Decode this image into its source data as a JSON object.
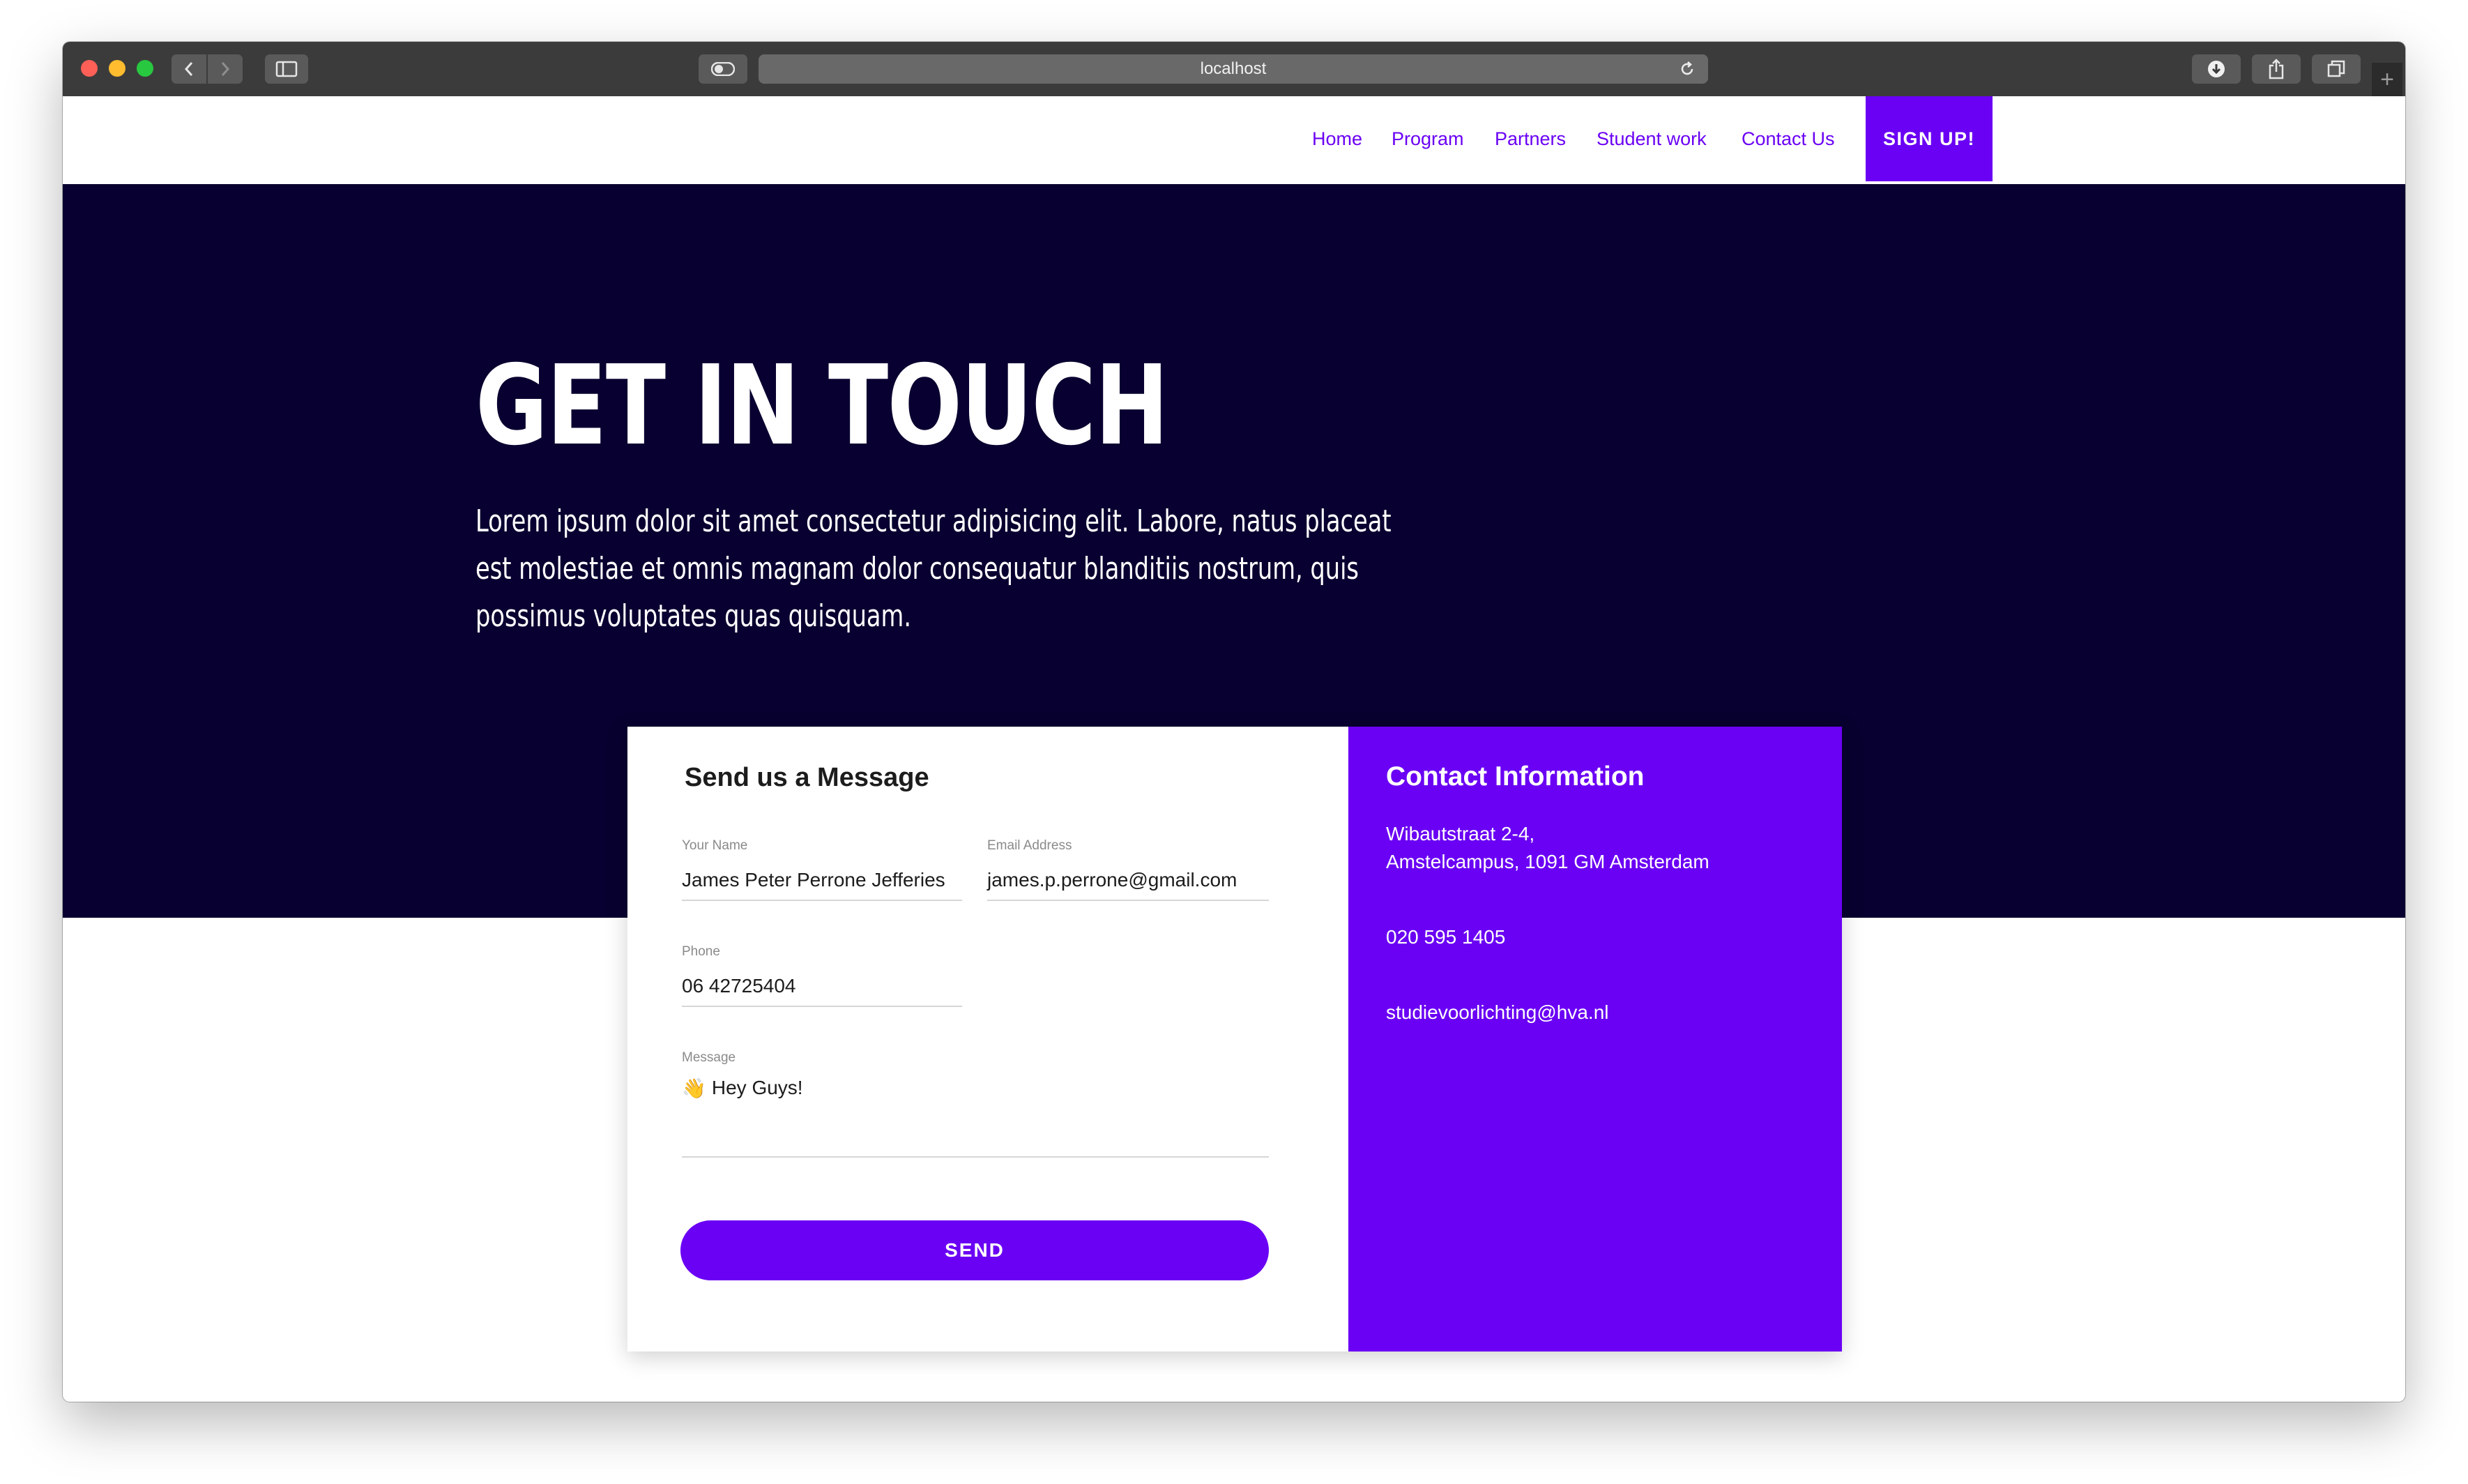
{
  "browser": {
    "url": "localhost"
  },
  "nav": {
    "links": [
      "Home",
      "Program",
      "Partners",
      "Student work",
      "Contact Us"
    ],
    "signup": "SIGN UP!"
  },
  "hero": {
    "title": "GET IN TOUCH",
    "text": "Lorem ipsum dolor sit amet consectetur adipisicing elit. Labore, natus placeat est molestiae et omnis magnam dolor consequatur blanditiis nostrum, quis possimus voluptates quas quisquam."
  },
  "form": {
    "title": "Send us a Message",
    "name_label": "Your Name",
    "name_value": "James Peter Perrone Jefferies",
    "email_label": "Email Address",
    "email_value": "james.p.perrone@gmail.com",
    "phone_label": "Phone",
    "phone_value": "06 42725404",
    "message_label": "Message",
    "message_emoji": "👋",
    "message_value": "Hey Guys!",
    "send_label": "SEND"
  },
  "contact_info": {
    "title": "Contact Information",
    "address_line1": "Wibautstraat 2-4,",
    "address_line2": "Amstelcampus, 1091 GM Amsterdam",
    "phone": "020 595 1405",
    "email": "studievoorlichting@hva.nl"
  },
  "colors": {
    "accent": "#6a00f4",
    "hero_bg": "#080030"
  }
}
